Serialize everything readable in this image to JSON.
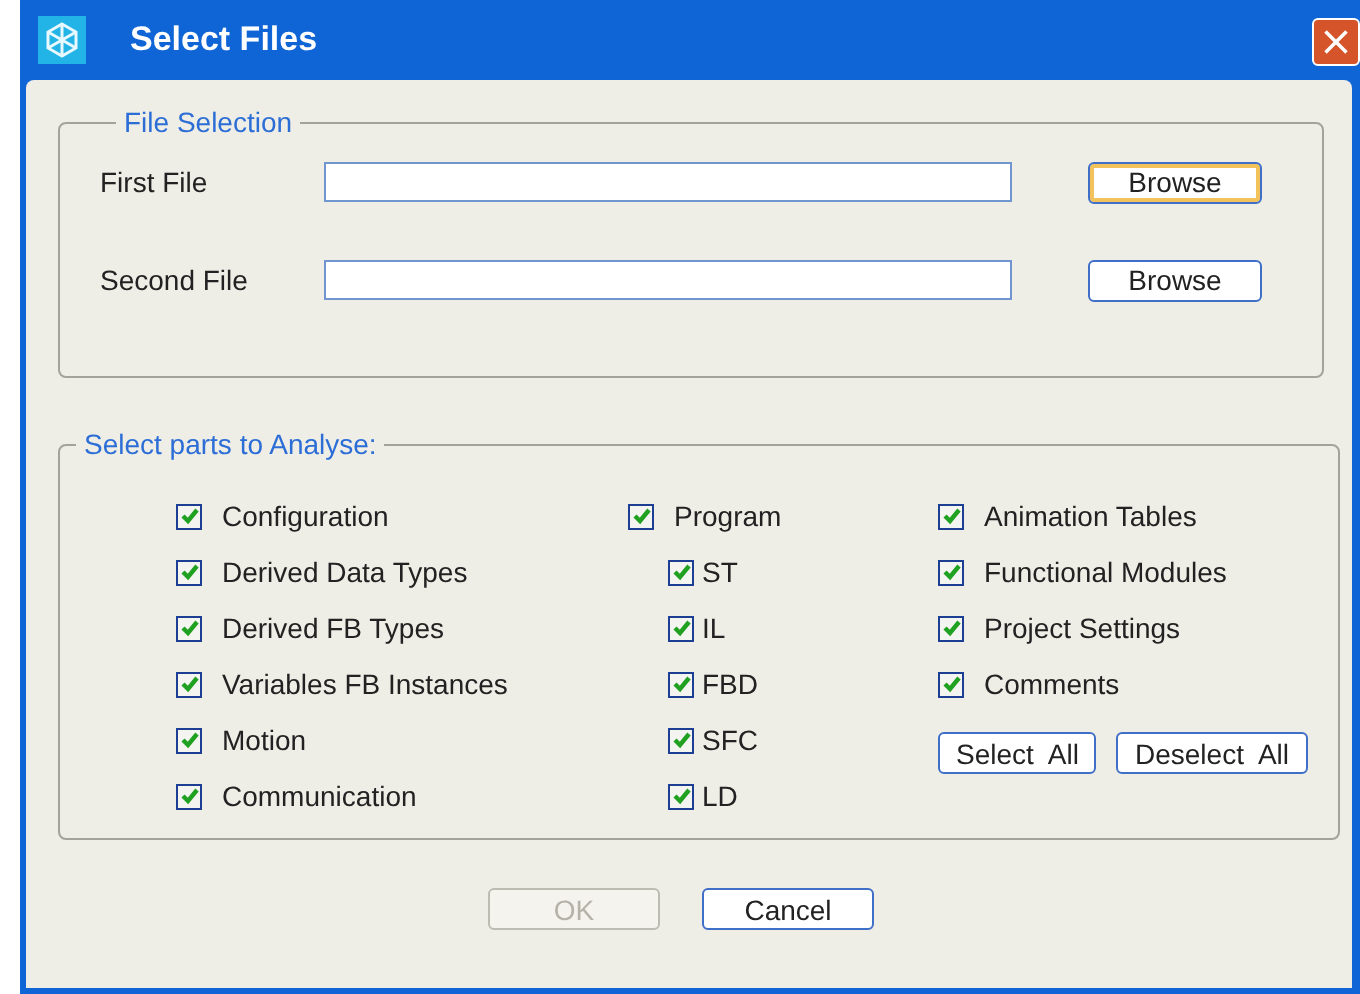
{
  "window": {
    "title": "Select Files"
  },
  "file_selection": {
    "title": "File Selection",
    "fields": [
      {
        "label": "First File",
        "button": "Browse",
        "focused": true
      },
      {
        "label": "Second File",
        "button": "Browse",
        "focused": false
      }
    ]
  },
  "parts": {
    "title": "Select parts to Analyse:",
    "columns": [
      [
        {
          "label": "Configuration",
          "checked": true
        },
        {
          "label": "Derived Data Types",
          "checked": true
        },
        {
          "label": "Derived FB Types",
          "checked": true
        },
        {
          "label": "Variables FB Instances",
          "checked": true
        },
        {
          "label": "Motion",
          "checked": true
        },
        {
          "label": "Communication",
          "checked": true
        }
      ],
      [
        {
          "label": "Program",
          "checked": true,
          "children": [
            {
              "label": "ST",
              "checked": true
            },
            {
              "label": "IL",
              "checked": true
            },
            {
              "label": "FBD",
              "checked": true
            },
            {
              "label": "SFC",
              "checked": true
            },
            {
              "label": "LD",
              "checked": true
            }
          ]
        }
      ],
      [
        {
          "label": "Animation Tables",
          "checked": true
        },
        {
          "label": "Functional Modules",
          "checked": true
        },
        {
          "label": "Project Settings",
          "checked": true
        },
        {
          "label": "Comments",
          "checked": true
        }
      ]
    ],
    "buttons": [
      "Select  All",
      "Deselect  All"
    ]
  },
  "buttons": [
    {
      "label": "OK",
      "disabled": true
    },
    {
      "label": "Cancel",
      "disabled": false
    }
  ]
}
